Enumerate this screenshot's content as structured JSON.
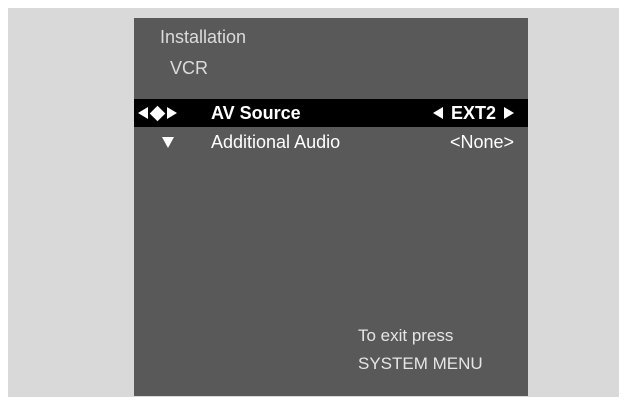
{
  "breadcrumb": {
    "level1": "Installation",
    "level2": "VCR"
  },
  "menu": {
    "items": [
      {
        "label": "AV Source",
        "value": "EXT2"
      },
      {
        "label": "Additional Audio",
        "value": "<None>"
      }
    ]
  },
  "footer": {
    "line1": "To exit press",
    "line2": "SYSTEM MENU"
  },
  "icons": [
    "left-arrow-icon",
    "diamond-icon",
    "right-arrow-icon",
    "down-arrow-icon"
  ],
  "colors": {
    "panel": "#595959",
    "frame": "#d9d9d9",
    "highlight": "#000000",
    "text": "#ffffff"
  }
}
